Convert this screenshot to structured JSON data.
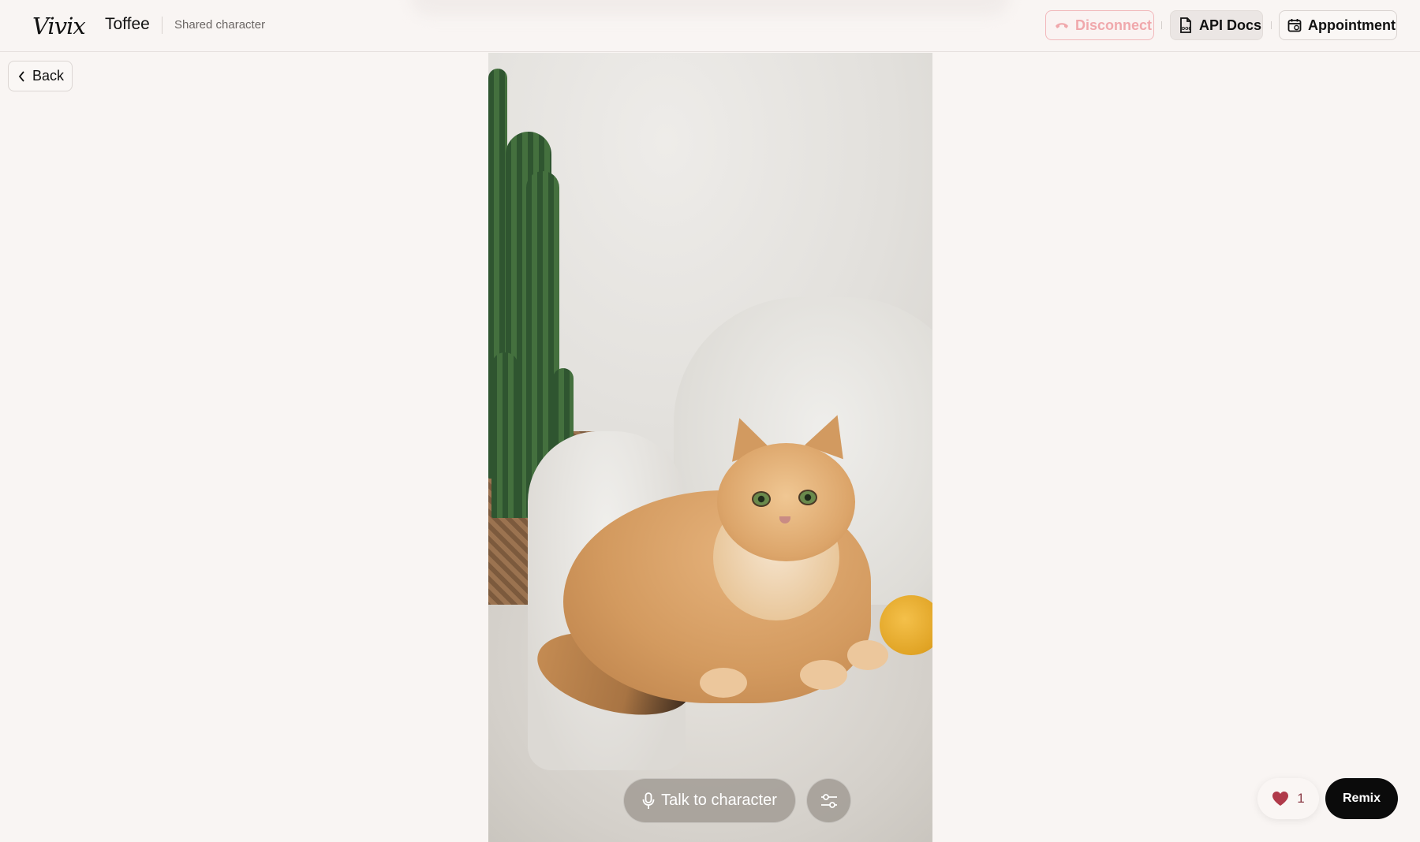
{
  "header": {
    "logo_text": "Vivix",
    "character_name": "Toffee",
    "subtitle": "Shared character",
    "disconnect_label": "Disconnect",
    "api_docs_label": "API Docs",
    "appointment_label": "Appointment"
  },
  "nav": {
    "back_label": "Back"
  },
  "controls": {
    "talk_label": "Talk to character"
  },
  "actions": {
    "like_count": "1",
    "remix_label": "Remix"
  },
  "colors": {
    "background": "#f9f5f3",
    "disconnect": "#f0a8ac",
    "heart": "#b03a4a",
    "remix_bg": "#0b0b0b"
  },
  "icons": {
    "disconnect": "phone-hangup-icon",
    "api_docs": "document-icon",
    "appointment": "calendar-icon",
    "back": "chevron-left-icon",
    "talk": "microphone-icon",
    "settings": "sliders-icon",
    "like": "heart-icon"
  }
}
